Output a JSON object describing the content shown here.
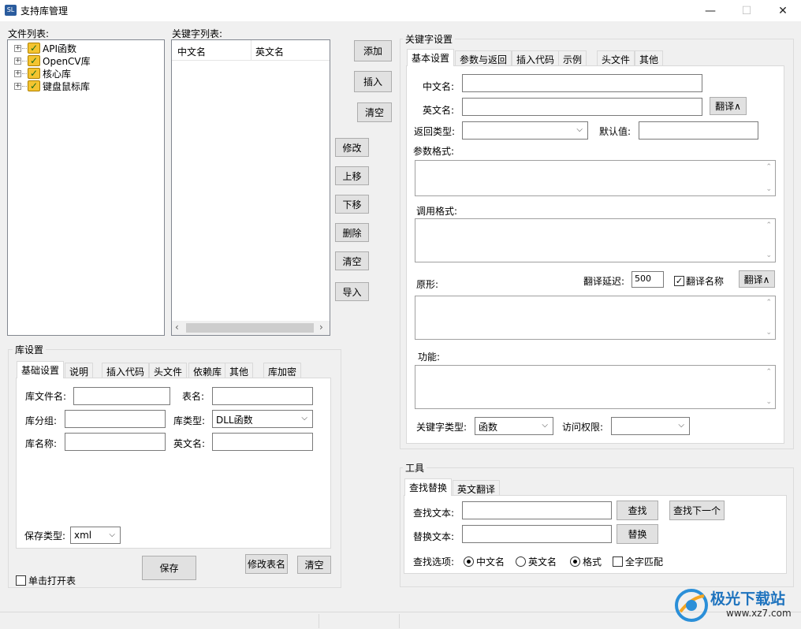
{
  "window": {
    "title": "支持库管理",
    "icon_text": "SL",
    "minimize": "—",
    "maximize": "☐",
    "close": "✕"
  },
  "file_list": {
    "label": "文件列表:",
    "items": [
      {
        "label": "API函数",
        "checked": true
      },
      {
        "label": "OpenCV库",
        "checked": true
      },
      {
        "label": "核心库",
        "checked": true
      },
      {
        "label": "键盘鼠标库",
        "checked": true
      }
    ]
  },
  "keyword_list": {
    "label": "关键字列表:",
    "columns": [
      "中文名",
      "英文名"
    ]
  },
  "middle_buttons": {
    "add": "添加",
    "insert": "插入",
    "clear1": "清空",
    "modify": "修改",
    "move_up": "上移",
    "move_down": "下移",
    "delete": "删除",
    "clear2": "清空",
    "import": "导入"
  },
  "lib_settings": {
    "title": "库设置",
    "tabs": [
      "基础设置",
      "说明",
      "插入代码",
      "头文件",
      "依赖库",
      "其他",
      "库加密"
    ],
    "file_name_label": "库文件名:",
    "table_name_label": "表名:",
    "group_label": "库分组:",
    "lib_type_label": "库类型:",
    "lib_type_value": "DLL函数",
    "lib_name_label": "库名称:",
    "en_name_label": "英文名:",
    "save_type_label": "保存类型:",
    "save_type_value": "xml",
    "save_button": "保存",
    "rename_table_button": "修改表名",
    "clear_button": "清空",
    "single_click_open": "单击打开表"
  },
  "keyword_settings": {
    "title": "关键字设置",
    "tabs": [
      "基本设置",
      "参数与返回",
      "插入代码",
      "示例",
      "头文件",
      "其他"
    ],
    "cn_name_label": "中文名:",
    "en_name_label": "英文名:",
    "translate_button": "翻译∧",
    "return_type_label": "返回类型:",
    "default_label": "默认值:",
    "param_format_label": "参数格式:",
    "call_format_label": "调用格式:",
    "prototype_label": "原形:",
    "translate_delay_label": "翻译延迟:",
    "translate_delay_value": "500",
    "translate_name_label": "翻译名称",
    "translate_name_checked": true,
    "translate_button2": "翻译∧",
    "function_label": "功能:",
    "keyword_type_label": "关键字类型:",
    "keyword_type_value": "函数",
    "access_label": "访问权限:",
    "access_value": ""
  },
  "tools": {
    "title": "工具",
    "tabs": [
      "查找替换",
      "英文翻译"
    ],
    "find_label": "查找文本:",
    "find_button": "查找",
    "find_next_button": "查找下一个",
    "replace_label": "替换文本:",
    "replace_button": "替换",
    "options_label": "查找选项:",
    "opt_cn": "中文名",
    "opt_en": "英文名",
    "opt_format": "格式",
    "opt_whole": "全字匹配",
    "selected_option": "格式"
  },
  "watermark": {
    "text": "极光下载站",
    "url": "www.xz7.com"
  }
}
